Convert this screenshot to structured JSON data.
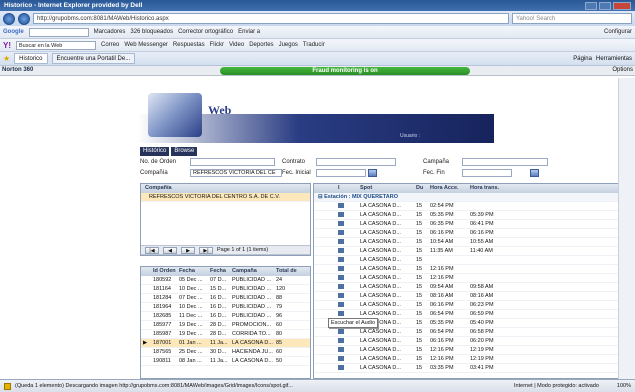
{
  "window": {
    "title": "Historico - Internet Explorer provided by Dell"
  },
  "address_bar": {
    "url": "http://grupobms.com:8081/MAWeb/Historico.aspx",
    "search_placeholder": "Yahoo! Search"
  },
  "google_toolbar": {
    "label": "Google",
    "items": [
      "Buscar en la Web",
      "Marcadores",
      "326 bloqueados",
      "Corrector ortográfico",
      "Enviar a",
      "Configurar"
    ]
  },
  "yahoo_toolbar": {
    "items": [
      "Buscar en la Web",
      "Correo",
      "Web Messenger",
      "Respuestas",
      "Flickr",
      "Video",
      "Deportes",
      "Juegos",
      "Traducir"
    ]
  },
  "tabs": [
    {
      "label": "Historico"
    },
    {
      "label": "Encuentre una Portatil De..."
    }
  ],
  "tab_commands": [
    "Página",
    "Herramientas"
  ],
  "norton": {
    "label": "Norton 360",
    "fraud": "Fraud monitoring is on",
    "options": "Options"
  },
  "banner": {
    "brand": "Web",
    "user_label": "Usuario :"
  },
  "buttons": {
    "historico": "Histórico",
    "browse": "Browse"
  },
  "form": {
    "orden_label": "No. de Orden",
    "contrato_label": "Contrato",
    "campana_label": "Campaña",
    "compania_label": "Compañía",
    "compania_value": "REFRESCOS VICTORIA DEL CE",
    "fec_inicial_label": "Fec. Inicial",
    "fec_fin_label": "Fec. Fin"
  },
  "company_grid": {
    "header": "Compañía",
    "rows": [
      "REFRESCOS VICTORIA DEL CENTRO S.A. DE C.V."
    ],
    "pager_text": "Page 1 of 1 (1 items)"
  },
  "orders_grid": {
    "columns": [
      "Id Orden",
      "Fecha",
      "Fecha",
      "Campaña",
      "Total de"
    ],
    "rows": [
      [
        "180592",
        "05 Dec ...",
        "07 D...",
        "PUBLICIDAD ...",
        "24"
      ],
      [
        "181164",
        "10 Dec ...",
        "15 D...",
        "PUBLICIDAD ...",
        "120"
      ],
      [
        "181284",
        "07 Dec ...",
        "16 D...",
        "PUBLICIDAD ...",
        "88"
      ],
      [
        "181964",
        "10 Dec ...",
        "16 D...",
        "PUBLICIDAD ...",
        "79"
      ],
      [
        "182685",
        "11 Dec ...",
        "16 D...",
        "PUBLICIDAD ...",
        "96"
      ],
      [
        "185977",
        "19 Dec ...",
        "28 D...",
        "PROMOCION...",
        "60"
      ],
      [
        "185987",
        "19 Dec ...",
        "28 D...",
        "CORRIDA TO...",
        "80"
      ],
      [
        "187001",
        "01 Jan ...",
        "11 Ja...",
        "LA CASONA D...",
        "85"
      ],
      [
        "187565",
        "25 Dec ...",
        "30 D...",
        "HACIENDA JU...",
        "60"
      ],
      [
        "190811",
        "08 Jan ...",
        "11 Ja...",
        "LA CASONA D...",
        "50"
      ]
    ],
    "selected_index": 7
  },
  "spots_grid": {
    "columns": [
      "I",
      "Spot",
      "Du",
      "Hora Acce.",
      "Hora trans."
    ],
    "group": "Estación : MIX QUERETARO",
    "rows": [
      [
        "LA CASONA D...",
        "15",
        "02:54 PM",
        ""
      ],
      [
        "LA CASONA D...",
        "15",
        "05:35 PM",
        "05:39 PM"
      ],
      [
        "LA CASONA D...",
        "15",
        "06:35 PM",
        "06:41 PM"
      ],
      [
        "LA CASONA D...",
        "15",
        "06:16 PM",
        "06:16 PM"
      ],
      [
        "LA CASONA D...",
        "15",
        "10:54 AM",
        "10:55 AM"
      ],
      [
        "LA CASONA D...",
        "15",
        "11:35 AM",
        "11:40 AM"
      ],
      [
        "LA CASONA D...",
        "15",
        "",
        ""
      ],
      [
        "LA CASONA D...",
        "15",
        "12:16 PM",
        ""
      ],
      [
        "LA CASONA D...",
        "15",
        "12:16 PM",
        ""
      ],
      [
        "LA CASONA D...",
        "15",
        "09:54 AM",
        "09:58 AM"
      ],
      [
        "LA CASONA D...",
        "15",
        "08:16 AM",
        "08:16 AM"
      ],
      [
        "LA CASONA D...",
        "15",
        "06:16 PM",
        "06:23 PM"
      ],
      [
        "LA CASONA D...",
        "15",
        "06:54 PM",
        "06:59 PM"
      ],
      [
        "LA CASONA D...",
        "15",
        "05:35 PM",
        "05:40 PM"
      ],
      [
        "LA CASONA D...",
        "15",
        "06:54 PM",
        "06:58 PM"
      ],
      [
        "LA CASONA D...",
        "15",
        "06:16 PM",
        "06:20 PM"
      ],
      [
        "LA CASONA D...",
        "15",
        "12:16 PM",
        "12:19 PM"
      ],
      [
        "LA CASONA D...",
        "15",
        "12:16 PM",
        "12:19 PM"
      ],
      [
        "LA CASONA D...",
        "15",
        "03:35 PM",
        "03:41 PM"
      ]
    ]
  },
  "tooltip": "Escuchar el Audio",
  "status": {
    "text": "(Queda 1 elemento) Descargando imagen http://grupobms.com:8081/MAWeb/images/Grid/images/Icons/spot.gif...",
    "zone": "Internet | Modo protegido: activado",
    "zoom": "100%"
  }
}
